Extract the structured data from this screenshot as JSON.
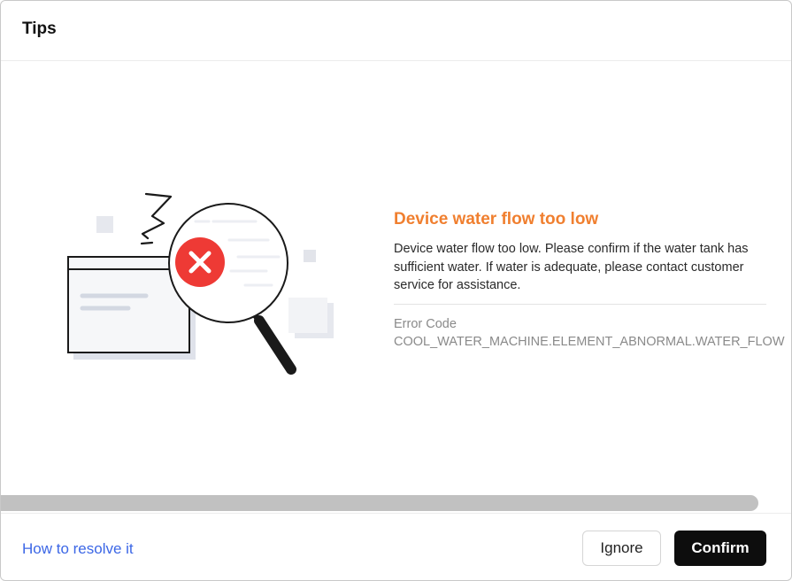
{
  "dialog": {
    "title": "Tips"
  },
  "error": {
    "title": "Device water flow too low",
    "description": "Device water flow too low. Please confirm if the water tank has sufficient water. If water is adequate, please contact customer service for assistance.",
    "code_label": "Error Code",
    "code_value": "COOL_WATER_MACHINE.ELEMENT_ABNORMAL.WATER_FLOW"
  },
  "illustration": {
    "icon": "magnifier-error-icon",
    "accent_color": "#ee3a35"
  },
  "footer": {
    "resolve_link": "How to resolve it",
    "ignore_label": "Ignore",
    "confirm_label": "Confirm"
  },
  "colors": {
    "error_title": "#f07f2f",
    "link": "#3c67e6",
    "confirm_bg": "#0d0d0d"
  }
}
